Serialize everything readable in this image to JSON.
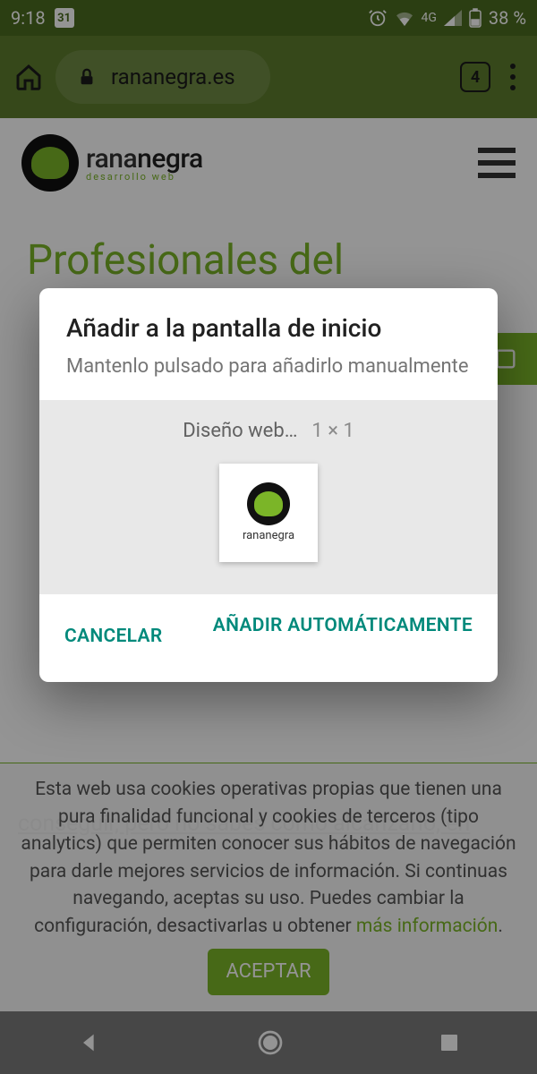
{
  "status": {
    "time": "9:18",
    "calendar_day": "31",
    "network": "4G",
    "battery": "38 %"
  },
  "browser": {
    "url": "rananegra.es",
    "tab_count": "4"
  },
  "site": {
    "logo_main": "rananegra",
    "logo_sub": "desarrollo web",
    "hero_line1": "Profesionales del",
    "body_partial": "conseguir, pero no sabes cómo alcanzarlo, en"
  },
  "cookies": {
    "text": "Esta web usa cookies operativas propias que tienen una pura finalidad funcional y cookies de terceros (tipo analytics) que permiten conocer sus hábitos de navegación para darle mejores servicios de información. Si continuas navegando, aceptas su uso. Puedes cambiar la configuración, desactivarlas u obtener ",
    "link": "más información",
    "dot": ".",
    "accept": "ACEPTAR"
  },
  "dialog": {
    "title": "Añadir a la pantalla de inicio",
    "subtitle": "Mantenlo pulsado para añadirlo manualmente",
    "app_name": "Diseño web…",
    "size": "1 × 1",
    "tile_label": "rananegra",
    "cancel": "CANCELAR",
    "add": "AÑADIR AUTOMÁTICAMENTE"
  }
}
